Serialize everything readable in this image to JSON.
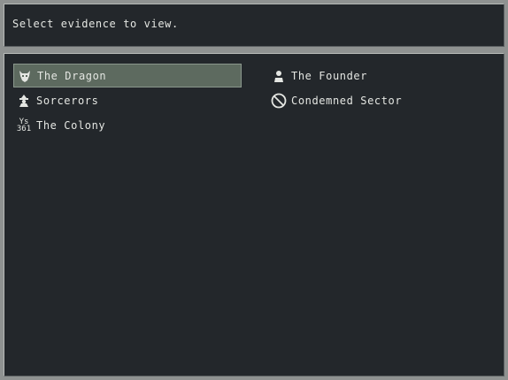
{
  "prompt": {
    "text": "Select evidence to view."
  },
  "evidence": {
    "items": [
      {
        "label": "The Dragon",
        "icon": "dragon-icon",
        "selected": true
      },
      {
        "label": "Sorcerors",
        "icon": "sorcerer-icon",
        "selected": false
      },
      {
        "label": "The Colony",
        "icon": "ys361-icon",
        "icon_text_top": "Ys",
        "icon_text_bottom": "361",
        "selected": false
      },
      {
        "label": "The Founder",
        "icon": "person-icon",
        "selected": false
      },
      {
        "label": "Condemned Sector",
        "icon": "prohibited-icon",
        "selected": false
      }
    ]
  },
  "colors": {
    "panel_bg": "#23272b",
    "frame": "#8f9291",
    "text": "#e4e6e2",
    "selected_bg": "#5d6a5f"
  }
}
